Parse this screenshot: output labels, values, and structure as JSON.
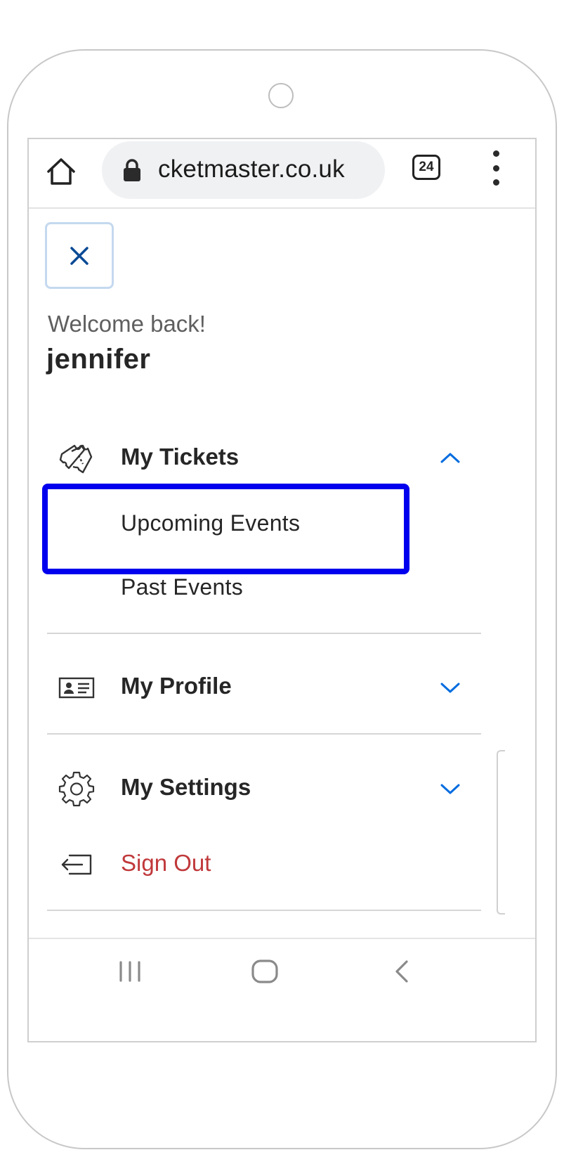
{
  "browser": {
    "url": "cketmaster.co.uk",
    "tab_count": "24",
    "icons": {
      "home": "home-icon",
      "lock": "lock-icon",
      "menu": "more-vertical-icon"
    }
  },
  "menu": {
    "close_icon": "close-icon",
    "welcome": "Welcome back!",
    "username": "jennifer",
    "sections": [
      {
        "label": "My Tickets",
        "icon": "tickets-icon",
        "expanded": true,
        "items": [
          "Upcoming Events",
          "Past Events"
        ]
      },
      {
        "label": "My Profile",
        "icon": "id-card-icon",
        "expanded": false
      },
      {
        "label": "My Settings",
        "icon": "gear-icon",
        "expanded": false
      }
    ],
    "sign_out": {
      "label": "Sign Out",
      "icon": "sign-out-icon"
    }
  },
  "colors": {
    "accent_blue": "#026cdf",
    "sign_out_red": "#c0393b",
    "highlight_box": "#0000ee"
  },
  "system_nav": {
    "icons": [
      "recent-apps-icon",
      "home-button-icon",
      "back-icon"
    ]
  }
}
